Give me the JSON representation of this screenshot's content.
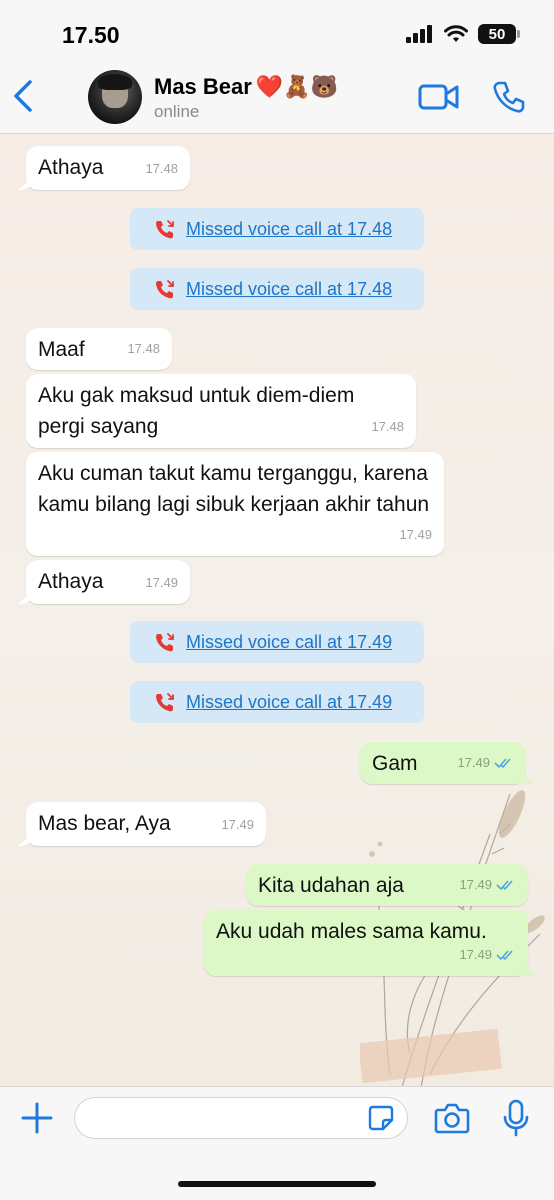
{
  "status_bar": {
    "time": "17.50",
    "battery": "50"
  },
  "header": {
    "contact_name": "Mas Bear",
    "name_emoji": "❤️🧸🐻",
    "contact_status": "online",
    "icons": [
      "back-chevron-icon",
      "video-call-icon",
      "phone-call-icon"
    ]
  },
  "messages": [
    {
      "type": "in",
      "text": "Athaya",
      "time": "17.48"
    },
    {
      "type": "missed_call",
      "text": "Missed voice call at 17.48"
    },
    {
      "type": "missed_call",
      "text": "Missed voice call at 17.48"
    },
    {
      "type": "in",
      "text": "Maaf",
      "time": "17.48"
    },
    {
      "type": "in",
      "text": "Aku gak maksud untuk diem-diem pergi sayang",
      "time": "17.48"
    },
    {
      "type": "in",
      "text": "Aku cuman takut kamu terganggu, karena kamu bilang lagi sibuk kerjaan akhir tahun",
      "time": "17.49"
    },
    {
      "type": "in",
      "text": "Athaya",
      "time": "17.49"
    },
    {
      "type": "missed_call",
      "text": "Missed voice call at 17.49"
    },
    {
      "type": "missed_call",
      "text": "Missed voice call at 17.49"
    },
    {
      "type": "out",
      "text": "Gam",
      "time": "17.49",
      "read": true
    },
    {
      "type": "in",
      "text": "Mas bear, Aya",
      "time": "17.49"
    },
    {
      "type": "out",
      "text": "Kita udahan aja",
      "time": "17.49",
      "read": true
    },
    {
      "type": "out",
      "text": "Aku udah males sama kamu.",
      "time": "17.49",
      "read": true
    }
  ],
  "input_bar": {
    "placeholder": "",
    "icons": [
      "plus-icon",
      "sticker-icon",
      "camera-icon",
      "microphone-icon"
    ]
  },
  "colors": {
    "accent": "#1f7ae0",
    "outgoing_bubble": "#dcf8c6",
    "incoming_bubble": "#ffffff",
    "missed_call_bg": "#d4e8f7",
    "missed_call_text": "#1f75c7",
    "read_ticks": "#4fa7e8"
  }
}
